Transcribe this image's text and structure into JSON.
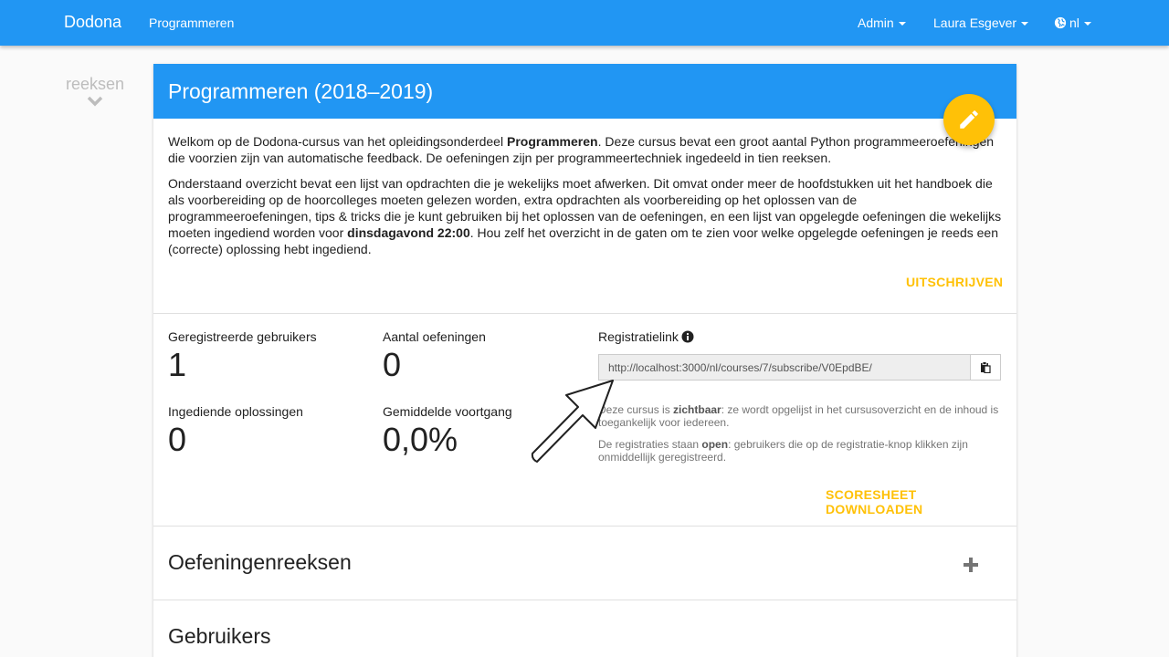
{
  "navbar": {
    "brand": "Dodona",
    "course_link": "Programmeren",
    "admin": "Admin",
    "user": "Laura Esgever",
    "language": "nl"
  },
  "sidenav": {
    "label": "reeksen"
  },
  "course": {
    "title": "Programmeren (2018–2019)",
    "desc1_a": "Welkom op de Dodona-cursus van het opleidingsonderdeel ",
    "desc1_b": "Programmeren",
    "desc1_c": ". Deze cursus bevat een groot aantal Python programmeeroefeningen die voorzien zijn van automatische feedback. De oefeningen zijn per programmeertechniek ingedeeld in tien reeksen.",
    "desc2_a": "Onderstaand overzicht bevat een lijst van opdrachten die je wekelijks moet afwerken. Dit omvat onder meer de hoofdstukken uit het handboek die als voorbereiding op de hoorcolleges moeten gelezen worden, extra opdrachten als voorbereiding op het oplossen van de programmeeroefeningen, tips & tricks die je kunt gebruiken bij het oplossen van de oefeningen, en een lijst van opgelegde oefeningen die wekelijks moeten ingediend worden voor ",
    "desc2_b": "dinsdagavond 22:00",
    "desc2_c": ". Hou zelf het overzicht in de gaten om te zien voor welke opgelegde oefeningen je reeds een (correcte) oplossing hebt ingediend.",
    "unsubscribe": "UITSCHRIJVEN"
  },
  "stats": {
    "registered_label": "Geregistreerde gebruikers",
    "registered_value": "1",
    "exercises_label": "Aantal oefeningen",
    "exercises_value": "0",
    "submitted_label": "Ingediende oplossingen",
    "submitted_value": "0",
    "progress_label": "Gemiddelde voortgang",
    "progress_value": "0,0%"
  },
  "registration": {
    "label": "Registratielink",
    "link": "http://localhost:3000/nl/courses/7/subscribe/V0EpdBE/",
    "visibility_a": "Deze cursus is ",
    "visibility_b": "zichtbaar",
    "visibility_c": ": ze wordt opgelijst in het cursusoverzicht en de inhoud is toegankelijk voor iedereen.",
    "open_a": "De registraties staan ",
    "open_b": "open",
    "open_c": ": gebruikers die op de registratie-knop klikken zijn onmiddellijk geregistreerd.",
    "scoresheet": "SCORESHEET DOWNLOADEN"
  },
  "sections": {
    "series": "Oefeningenreeksen",
    "users": "Gebruikers"
  },
  "colors": {
    "primary": "#2196f3",
    "accent": "#ffc107"
  }
}
